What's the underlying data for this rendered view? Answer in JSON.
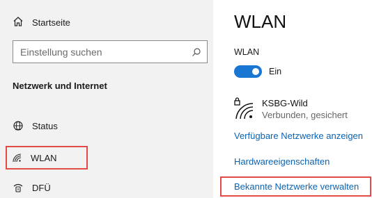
{
  "sidebar": {
    "home_label": "Startseite",
    "search_placeholder": "Einstellung suchen",
    "section_title": "Netzwerk und Internet",
    "items": [
      {
        "label": "Status",
        "icon": "globe-icon"
      },
      {
        "label": "WLAN",
        "icon": "wifi-icon",
        "selected": true
      },
      {
        "label": "DFÜ",
        "icon": "dialup-icon"
      }
    ]
  },
  "main": {
    "title": "WLAN",
    "wlan_label": "WLAN",
    "toggle": {
      "state": "Ein",
      "on": true
    },
    "network": {
      "name": "KSBG-Wild",
      "status": "Verbunden, gesichert"
    },
    "links": {
      "available": "Verfügbare Netzwerke anzeigen",
      "hardware": "Hardwareeigenschaften",
      "known": "Bekannte Netzwerke verwalten"
    }
  },
  "colors": {
    "accent": "#1976d2",
    "link": "#0a63b3",
    "highlight": "#e14a45",
    "sidebar_bg": "#f2f2f2"
  }
}
